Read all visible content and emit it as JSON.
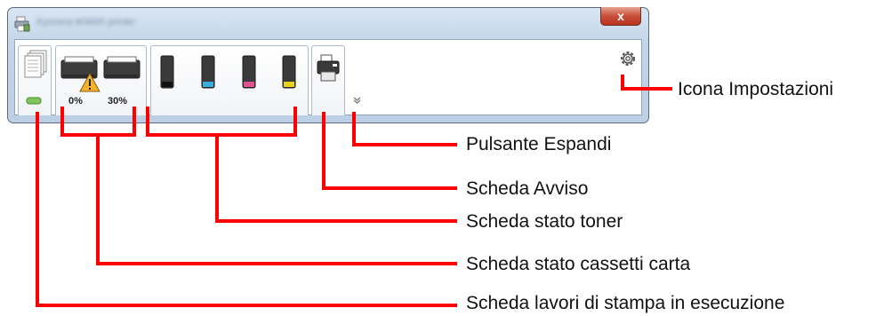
{
  "window": {
    "title": "Kyocera M3655 printer",
    "close_label": "x"
  },
  "paper_tab": {
    "cassette1_level": "0%",
    "cassette2_level": "30%"
  },
  "colors": {
    "annotation": "#ff0000",
    "toner_cyan": "#3aaed8",
    "toner_magenta": "#e0508f",
    "toner_yellow": "#e8d21d",
    "warning": "#f2b230"
  },
  "icons": {
    "jobs": "print-jobs-icon",
    "cassette1": "paper-cassette-icon",
    "cassette2": "paper-cassette-icon",
    "warning": "warning-icon",
    "toner": "toner-cartridge-icon",
    "alert": "printer-icon",
    "settings": "gear-icon",
    "expand": "chevron-down-icon"
  },
  "annotations": {
    "settings_icon": "Icona Impostazioni",
    "expand_button": "Pulsante Espandi",
    "alert_tab": "Scheda Avviso",
    "toner_tab": "Scheda stato toner",
    "paper_tab": "Scheda stato cassetti carta",
    "jobs_tab": "Scheda lavori di stampa in esecuzione"
  }
}
